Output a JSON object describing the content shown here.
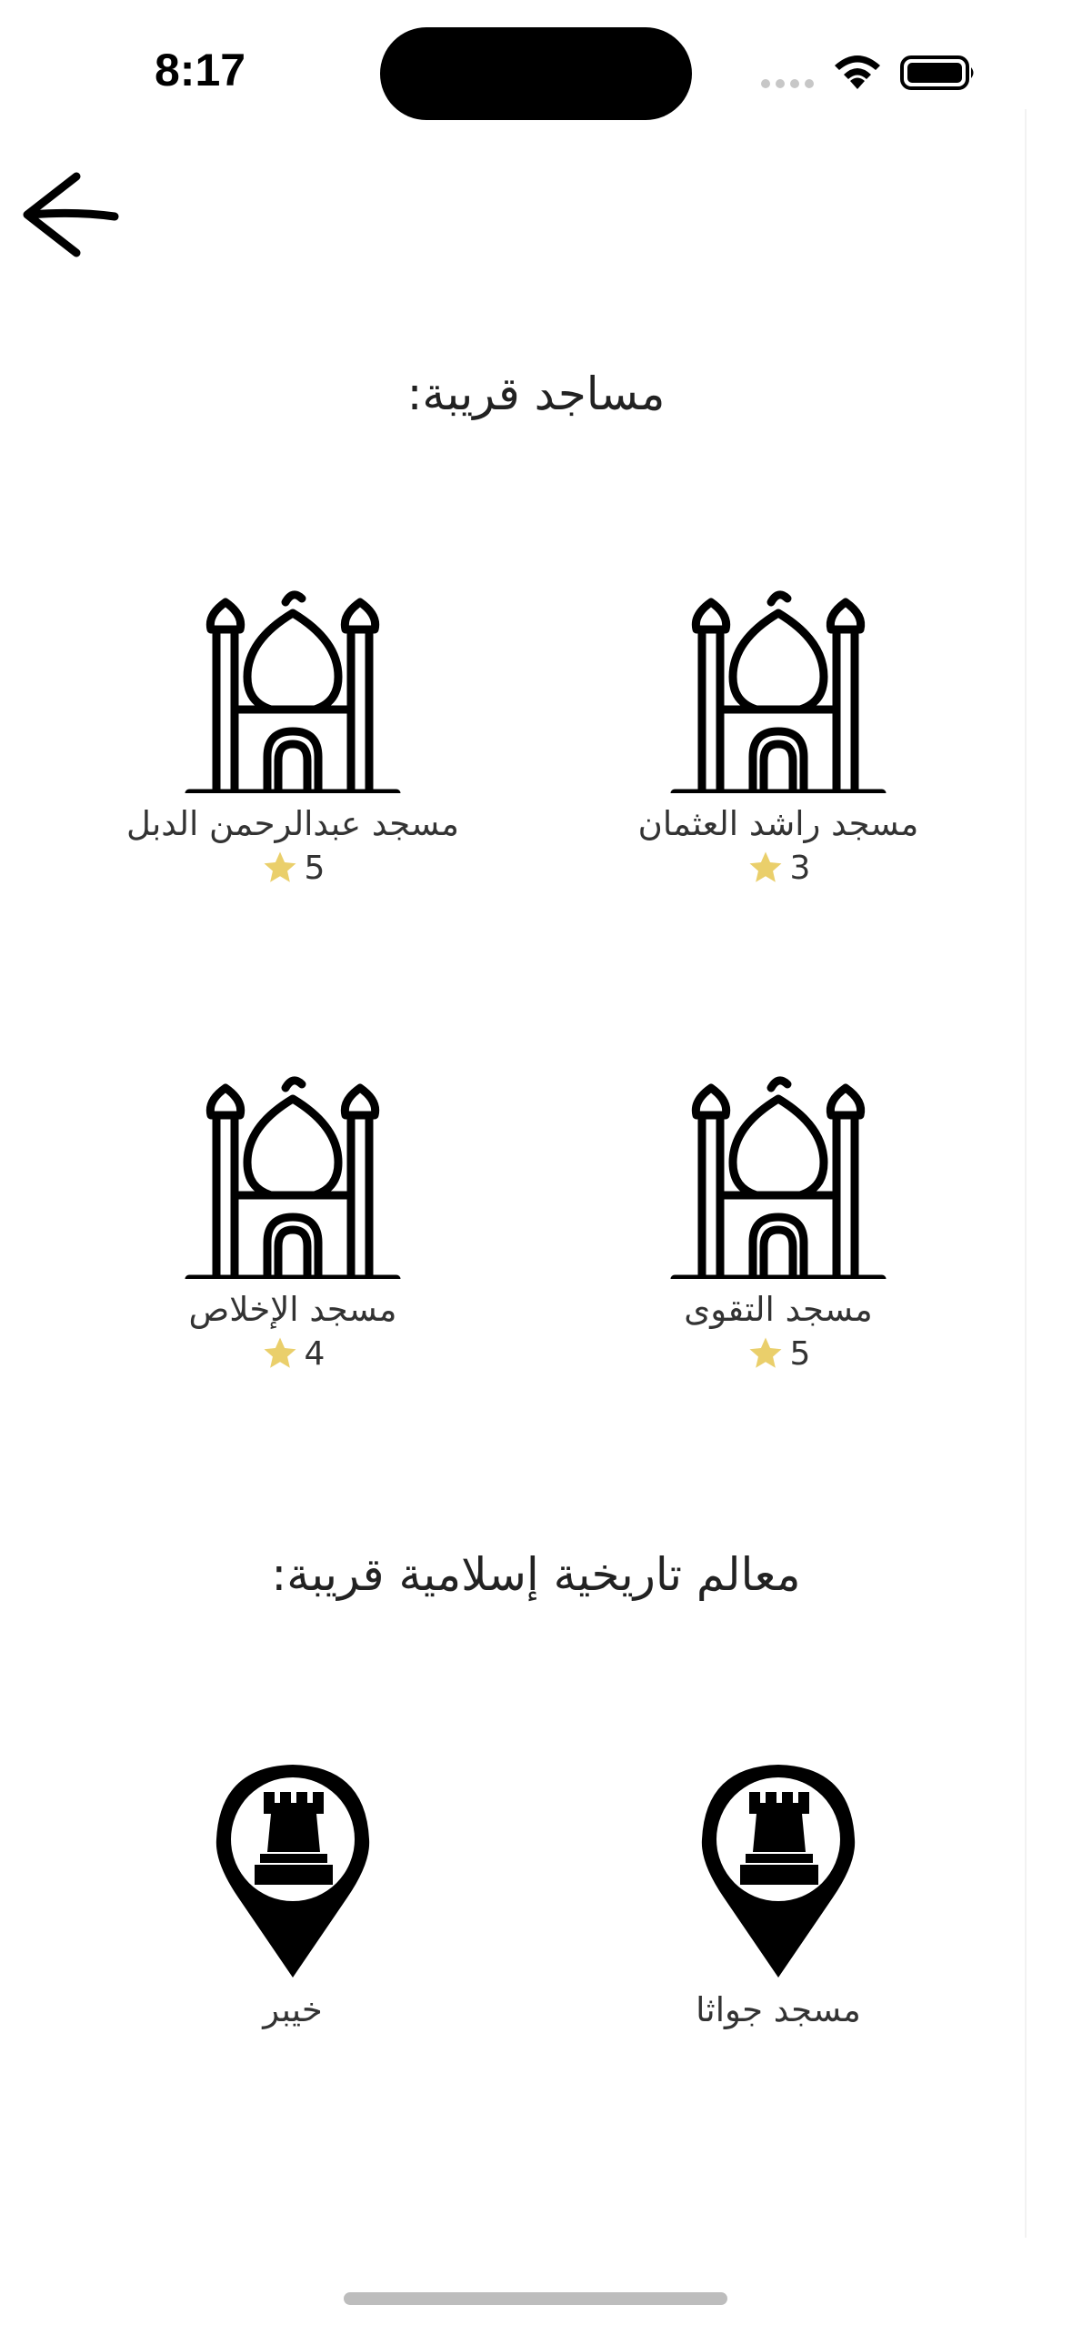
{
  "status_bar": {
    "time": "8:17"
  },
  "nearby_mosques": {
    "title": "مساجد قريبة:",
    "items": [
      {
        "name": "مسجد راشد العثمان",
        "rating": "3"
      },
      {
        "name": "مسجد عبدالرحمن الدبل",
        "rating": "5"
      },
      {
        "name": "مسجد التقوى",
        "rating": "5"
      },
      {
        "name": "مسجد الإخلاص",
        "rating": "4"
      }
    ]
  },
  "landmarks": {
    "title": "معالم تاريخية إسلامية قريبة:",
    "items": [
      {
        "name": "مسجد جواثا"
      },
      {
        "name": "خيبر"
      }
    ]
  },
  "icons": {
    "back": "arrow-left-icon",
    "mosque": "mosque-icon",
    "landmark": "map-pin-castle-icon",
    "star": "star-icon"
  },
  "colors": {
    "star": "#EACF6B",
    "icon": "#000000",
    "text": "#333333"
  }
}
